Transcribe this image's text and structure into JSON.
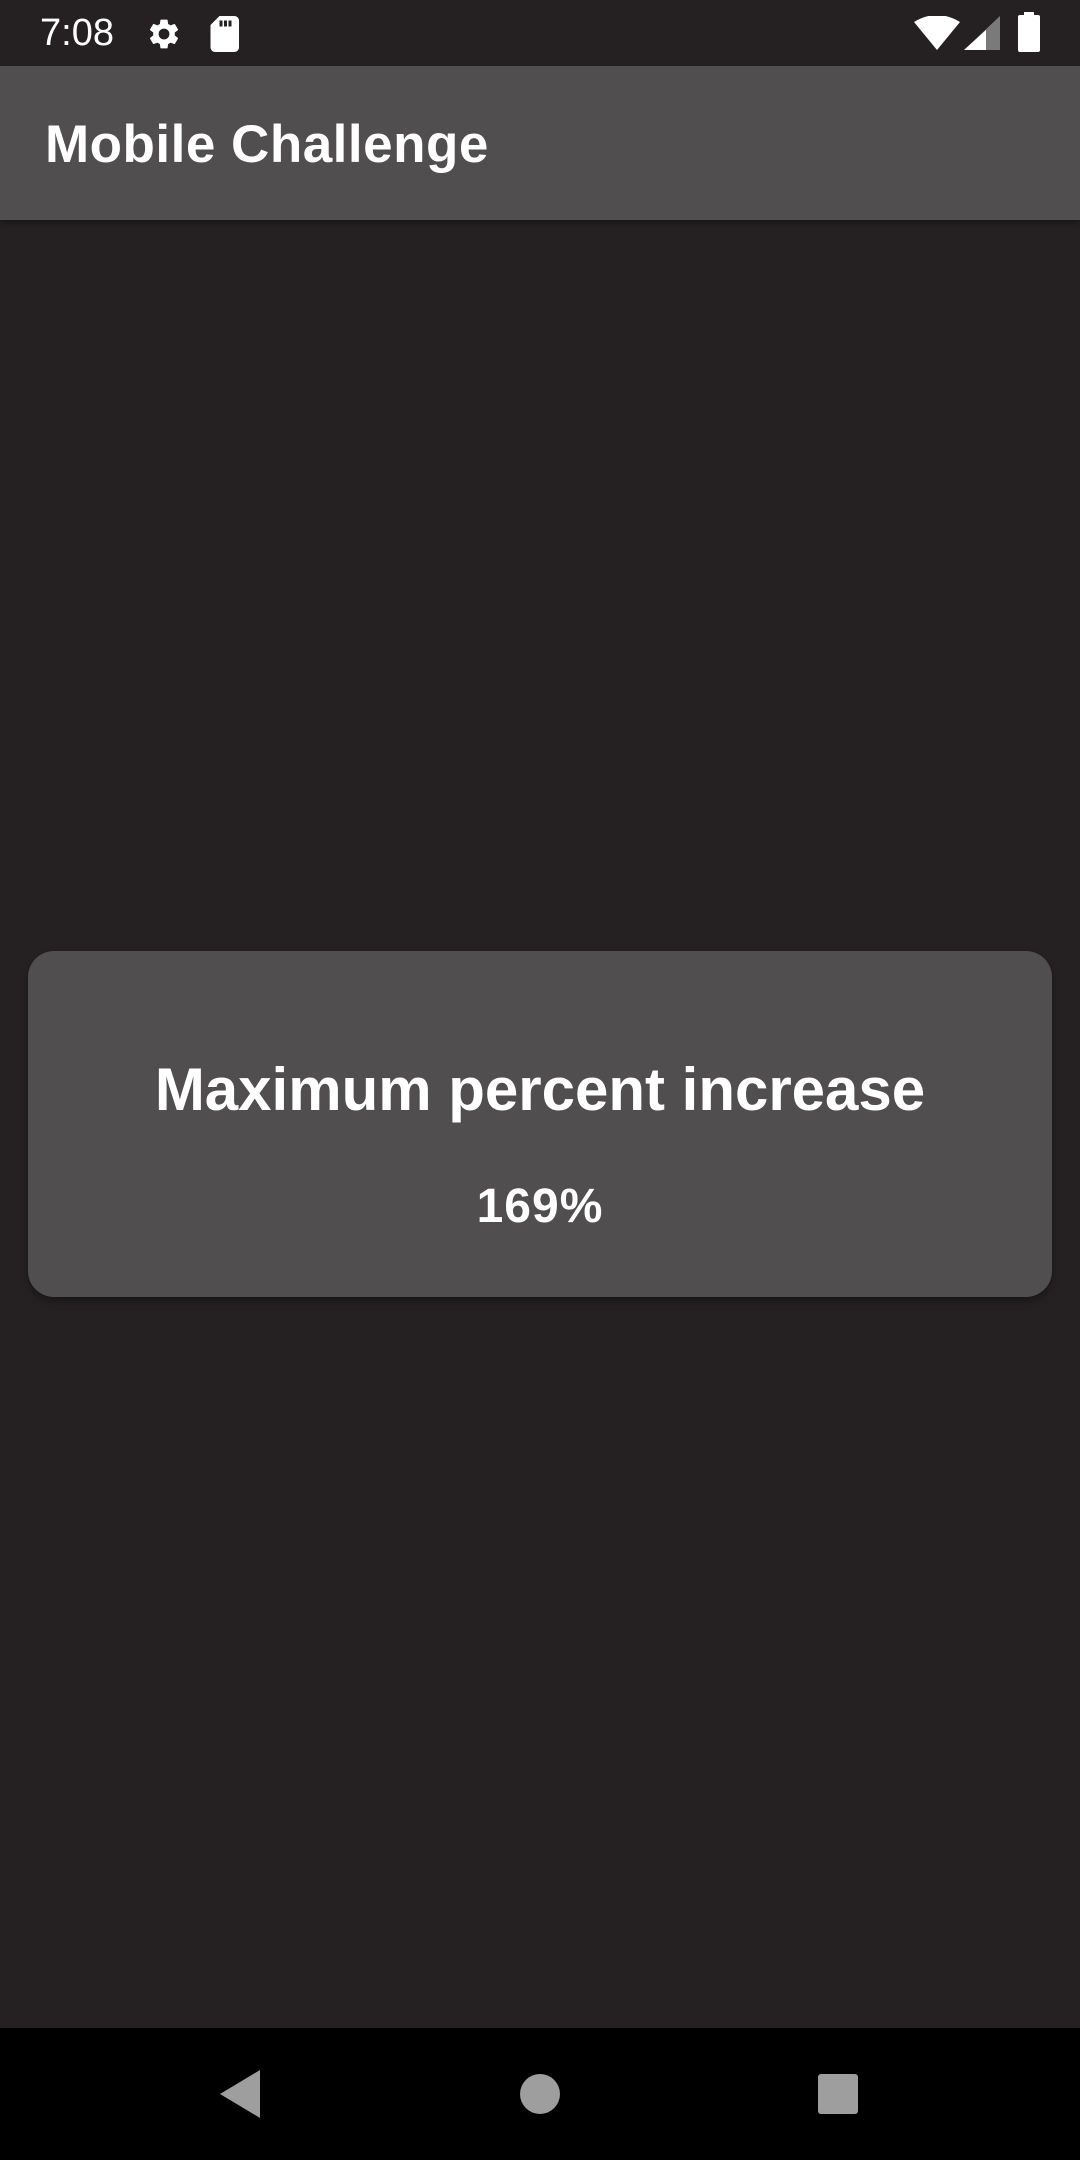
{
  "status_bar": {
    "time": "7:08",
    "icons": [
      "gear-icon",
      "sd-card-icon",
      "wifi-icon",
      "cell-signal-icon",
      "battery-icon"
    ]
  },
  "app_bar": {
    "title": "Mobile Challenge"
  },
  "card": {
    "title": "Maximum percent increase",
    "value": "169%"
  },
  "nav_bar": {
    "buttons": [
      "back-icon",
      "home-icon",
      "recents-icon"
    ]
  },
  "colors": {
    "background": "#252122",
    "surface": "#504e4f",
    "text": "#ffffff",
    "nav_background": "#000000",
    "nav_icon": "#9e9e9e"
  }
}
